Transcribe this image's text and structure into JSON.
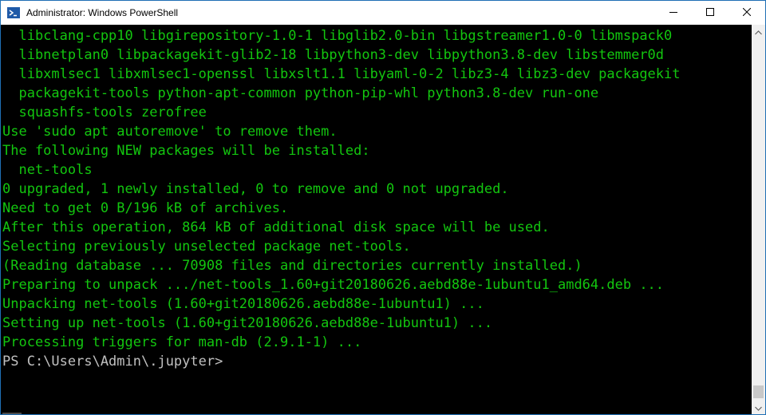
{
  "window": {
    "title": "Administrator: Windows PowerShell"
  },
  "icons": {
    "app": "powershell-icon",
    "minimize": "minimize-icon",
    "maximize": "maximize-icon",
    "close": "close-icon",
    "scroll_up": "scroll-up-arrow-icon",
    "scroll_down": "scroll-down-arrow-icon"
  },
  "colors": {
    "output_text": "#13c60f",
    "prompt_text": "#c0c0c0",
    "background": "#000000",
    "titlebar": "#ffffff"
  },
  "console": {
    "lines": [
      "  libclang-cpp10 libgirepository-1.0-1 libglib2.0-bin libgstreamer1.0-0 libmspack0",
      "  libnetplan0 libpackagekit-glib2-18 libpython3-dev libpython3.8-dev libstemmer0d",
      "  libxmlsec1 libxmlsec1-openssl libxslt1.1 libyaml-0-2 libz3-4 libz3-dev packagekit",
      "  packagekit-tools python-apt-common python-pip-whl python3.8-dev run-one",
      "  squashfs-tools zerofree",
      "Use 'sudo apt autoremove' to remove them.",
      "The following NEW packages will be installed:",
      "  net-tools",
      "0 upgraded, 1 newly installed, 0 to remove and 0 not upgraded.",
      "Need to get 0 B/196 kB of archives.",
      "After this operation, 864 kB of additional disk space will be used.",
      "Selecting previously unselected package net-tools.",
      "(Reading database ... 70908 files and directories currently installed.)",
      "Preparing to unpack .../net-tools_1.60+git20180626.aebd88e-1ubuntu1_amd64.deb ...",
      "Unpacking net-tools (1.60+git20180626.aebd88e-1ubuntu1) ...",
      "Setting up net-tools (1.60+git20180626.aebd88e-1ubuntu1) ...",
      "Processing triggers for man-db (2.9.1-1) ...",
      "PS C:\\Users\\Admin\\.jupyter>"
    ]
  }
}
